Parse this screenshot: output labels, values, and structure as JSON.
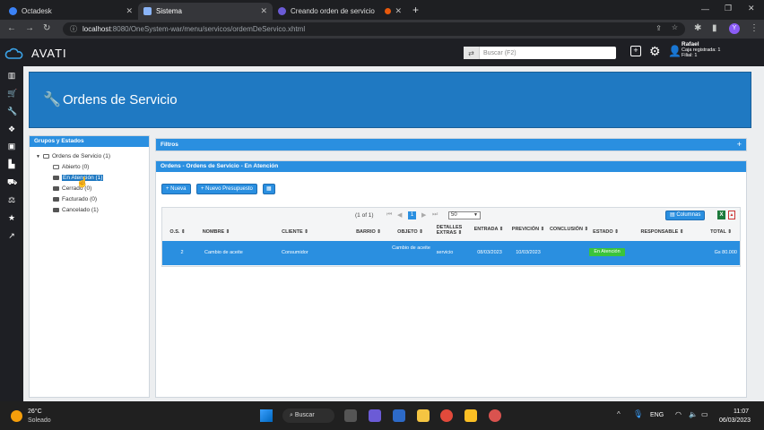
{
  "browser": {
    "tabs": [
      {
        "title": "Octadesk",
        "active": false
      },
      {
        "title": "Sistema",
        "active": true
      },
      {
        "title": "Creando orden de servicio",
        "active": false
      }
    ],
    "url_host": "localhost",
    "url_path": ":8080/OneSystem-war/menu/servicos/ordemDeServico.xhtml",
    "avatar_letter": "Y"
  },
  "app": {
    "logo": "AVATI",
    "search_placeholder": "Buscar (F2)",
    "user_name": "Rafael",
    "user_line1": "Caja registrada: 1",
    "user_line2": "Filial: 1"
  },
  "page": {
    "title": "Ordens de Servicio",
    "groups_header": "Grupos y Estados",
    "filters_header": "Filtros",
    "list_header": "Ordens - Ordens de Servicio - En Atención"
  },
  "tree": {
    "root": "Ordens de Servicio (1)",
    "items": [
      {
        "label": "Abierto (0)"
      },
      {
        "label": "En Atención (1)",
        "selected": true
      },
      {
        "label": "Cerrado (0)"
      },
      {
        "label": "Facturado (0)"
      },
      {
        "label": "Cancelado (1)"
      }
    ]
  },
  "toolbar": {
    "new_label": "Nueva",
    "new_budget_label": "Nuevo Presupuesto",
    "columns_label": "Columnas"
  },
  "pager": {
    "info": "(1 of 1)",
    "current_page": "1",
    "rows_per_page": "50"
  },
  "table": {
    "headers": [
      "O.S.",
      "NOMBRE",
      "CLIENTE",
      "BARRIO",
      "OBJETO",
      "DETALLES EXTRAS",
      "ENTRADA",
      "PREVICIÓN",
      "CONCLUSIÓN",
      "ESTADO",
      "RESPONSABLE",
      "TOTAL"
    ],
    "rows": [
      {
        "os": "2",
        "nombre": "Cambio de aceite",
        "cliente": "Consumidor",
        "barrio": "",
        "objeto": "Cambio de aceite",
        "detalles": "servicio",
        "entrada": "08/03/2023",
        "prevision": "10/03/2023",
        "conclusion": "",
        "estado": "En Atención",
        "responsable": "",
        "total": "Gs 80.000"
      }
    ]
  },
  "taskbar": {
    "weather_temp": "26°C",
    "weather_desc": "Soleado",
    "search_label": "Buscar",
    "lang": "ENG",
    "time": "11:07",
    "date": "06/03/2023"
  },
  "colors": {
    "primary": "#2a8fe0",
    "banner": "#1f79c2",
    "header": "#1e1f24",
    "status_green": "#3bc43b"
  }
}
